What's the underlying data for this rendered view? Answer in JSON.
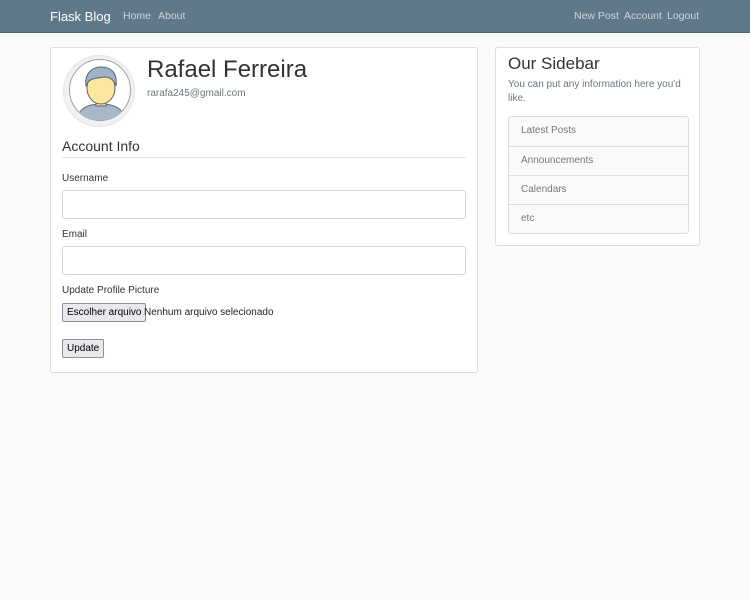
{
  "navbar": {
    "brand": "Flask Blog",
    "left_links": [
      "Home",
      "About"
    ],
    "right_links": [
      "New Post",
      "Account",
      "Logout"
    ]
  },
  "account": {
    "name": "Rafael Ferreira",
    "email": "rarafa245@gmail.com",
    "avatar_icon": "default-profile-avatar-icon"
  },
  "form": {
    "section_title": "Account Info",
    "username_label": "Username",
    "username_value": "",
    "email_label": "Email",
    "email_value": "",
    "picture_label": "Update Profile Picture",
    "file_button_label": "Escolher arquivo",
    "file_status": "Nenhum arquivo selecionado",
    "submit_label": "Update"
  },
  "sidebar": {
    "title": "Our Sidebar",
    "description": "You can put any information here you'd like.",
    "items": [
      "Latest Posts",
      "Announcements",
      "Calendars",
      "etc"
    ]
  },
  "colors": {
    "navbar_bg": "#5f788a",
    "page_bg": "#fafafa"
  }
}
